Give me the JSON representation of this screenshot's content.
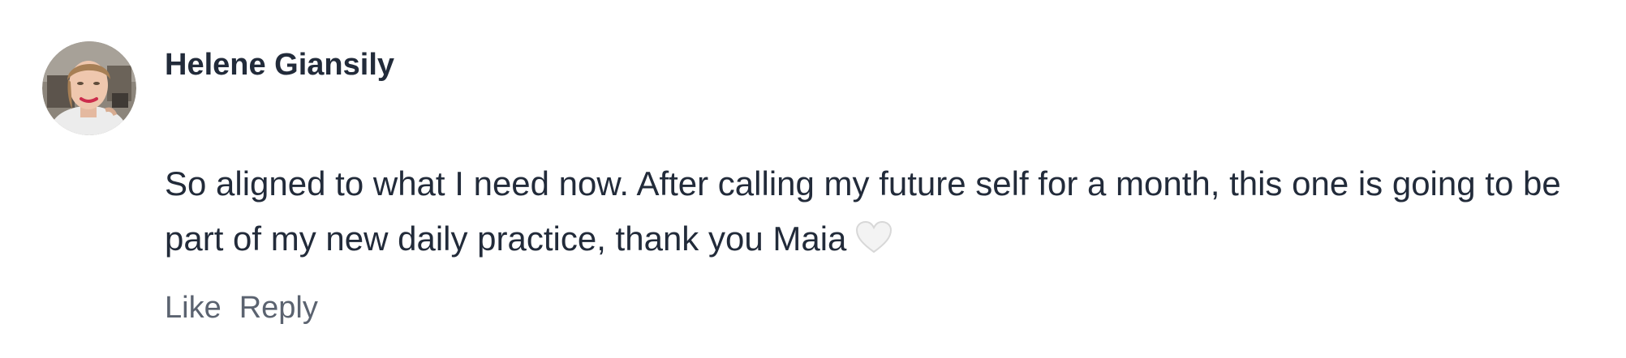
{
  "comment": {
    "author": "Helene Giansily",
    "text": "So aligned to what I need now. After calling my future self for a month, this one is going to be part of my new daily practice, thank you Maia",
    "emoji_icon": "white-heart-icon",
    "actions": {
      "like_label": "Like",
      "reply_label": "Reply"
    }
  },
  "colors": {
    "text": "#222b3a",
    "action_text": "#5b6370",
    "heart_fill": "#f3f3f3",
    "heart_stroke": "#d8d8d8"
  }
}
